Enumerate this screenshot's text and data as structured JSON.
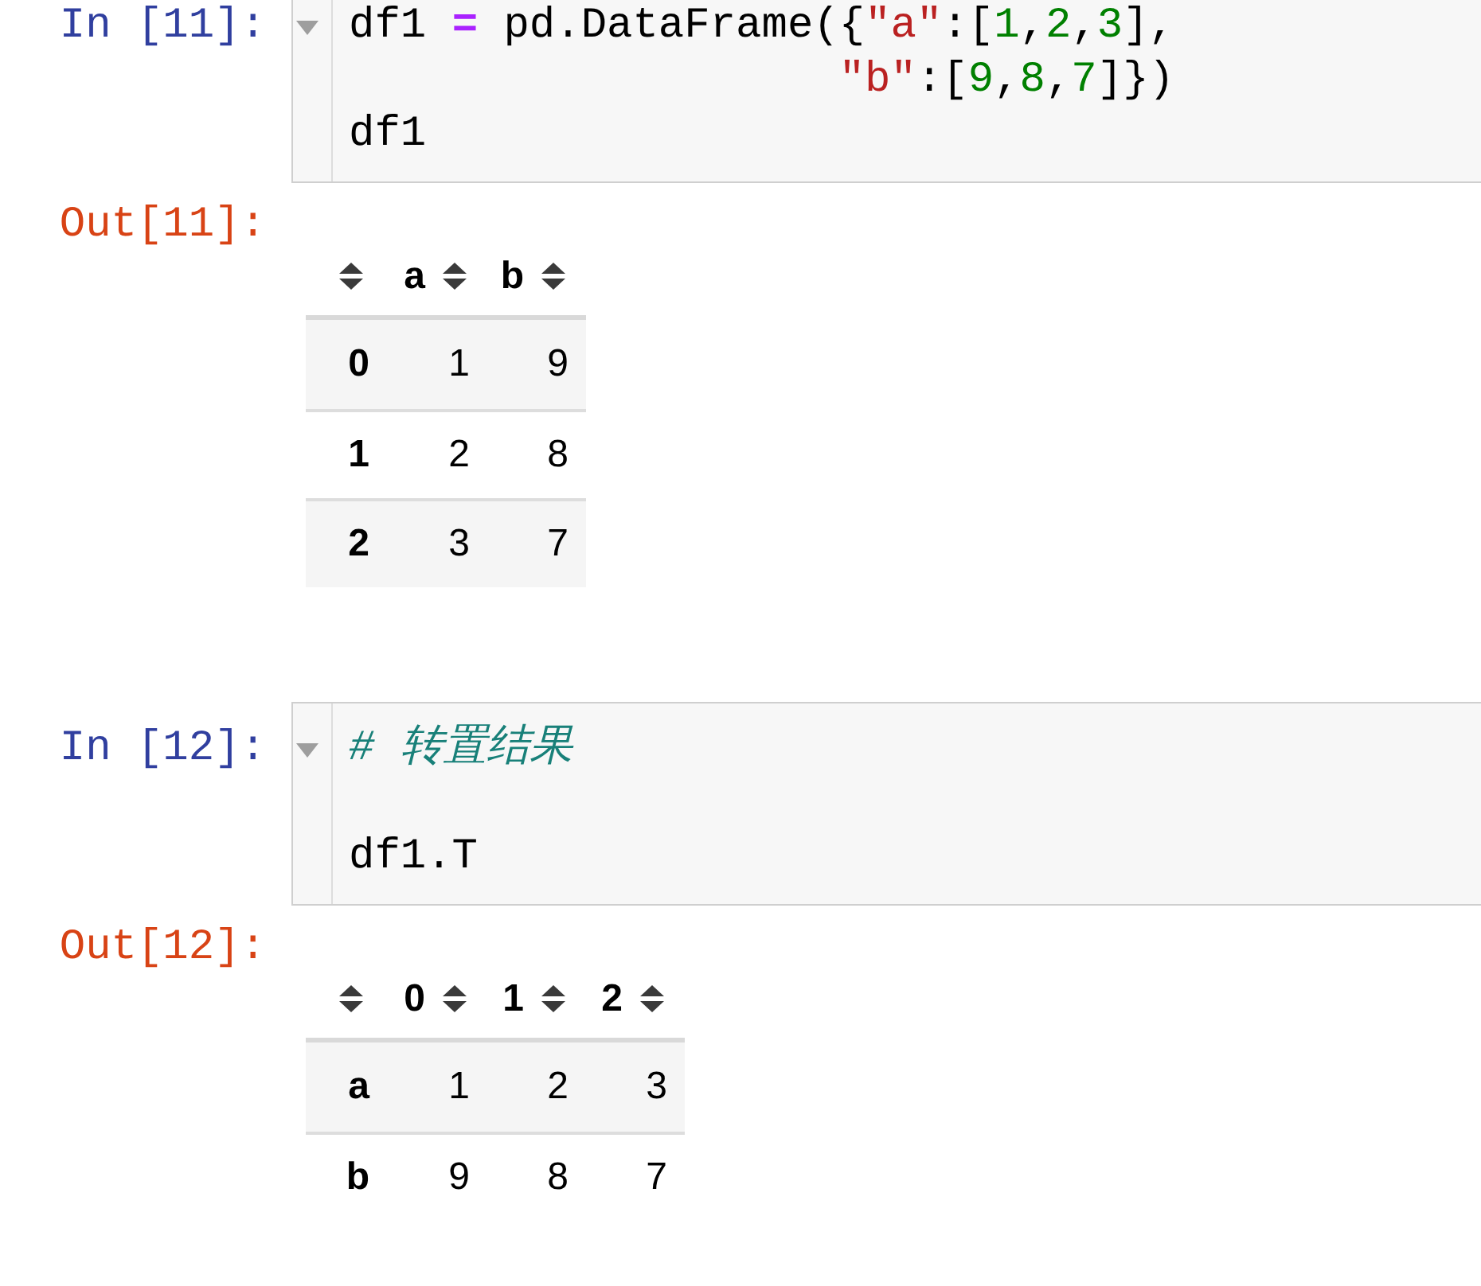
{
  "cells": [
    {
      "kind": "input",
      "prompt": "In [11]:",
      "lines": [
        {
          "kind": "code",
          "tokens": [
            {
              "kind": "plain",
              "text": "df1 "
            },
            {
              "kind": "operator",
              "text": "="
            },
            {
              "kind": "plain",
              "text": " pd.DataFrame({"
            },
            {
              "kind": "string",
              "text": "\"a\""
            },
            {
              "kind": "plain",
              "text": ":["
            },
            {
              "kind": "number",
              "text": "1"
            },
            {
              "kind": "plain",
              "text": ","
            },
            {
              "kind": "number",
              "text": "2"
            },
            {
              "kind": "plain",
              "text": ","
            },
            {
              "kind": "number",
              "text": "3"
            },
            {
              "kind": "plain",
              "text": "],"
            }
          ]
        },
        {
          "kind": "continuation",
          "tokens": [
            {
              "kind": "string",
              "text": "\"b\""
            },
            {
              "kind": "plain",
              "text": ":["
            },
            {
              "kind": "number",
              "text": "9"
            },
            {
              "kind": "plain",
              "text": ","
            },
            {
              "kind": "number",
              "text": "8"
            },
            {
              "kind": "plain",
              "text": ","
            },
            {
              "kind": "number",
              "text": "7"
            },
            {
              "kind": "plain",
              "text": "]})"
            }
          ]
        },
        {
          "kind": "code",
          "tokens": [
            {
              "kind": "plain",
              "text": "df1"
            }
          ]
        }
      ]
    },
    {
      "kind": "output",
      "prompt": "Out[11]:",
      "table": {
        "columns": [
          "a",
          "b"
        ],
        "rows": [
          {
            "index": "0",
            "values": [
              "1",
              "9"
            ]
          },
          {
            "index": "1",
            "values": [
              "2",
              "8"
            ]
          },
          {
            "index": "2",
            "values": [
              "3",
              "7"
            ]
          }
        ]
      }
    },
    {
      "kind": "input",
      "prompt": "In [12]:",
      "lines": [
        {
          "kind": "code",
          "tokens": [
            {
              "kind": "comment",
              "text": "# 转置结果"
            }
          ]
        },
        {
          "kind": "blank"
        },
        {
          "kind": "code",
          "tokens": [
            {
              "kind": "plain",
              "text": "df1.T"
            }
          ]
        }
      ]
    },
    {
      "kind": "output",
      "prompt": "Out[12]:",
      "table": {
        "columns": [
          "0",
          "1",
          "2"
        ],
        "rows": [
          {
            "index": "a",
            "values": [
              "1",
              "2",
              "3"
            ]
          },
          {
            "index": "b",
            "values": [
              "9",
              "8",
              "7"
            ]
          }
        ]
      }
    }
  ]
}
